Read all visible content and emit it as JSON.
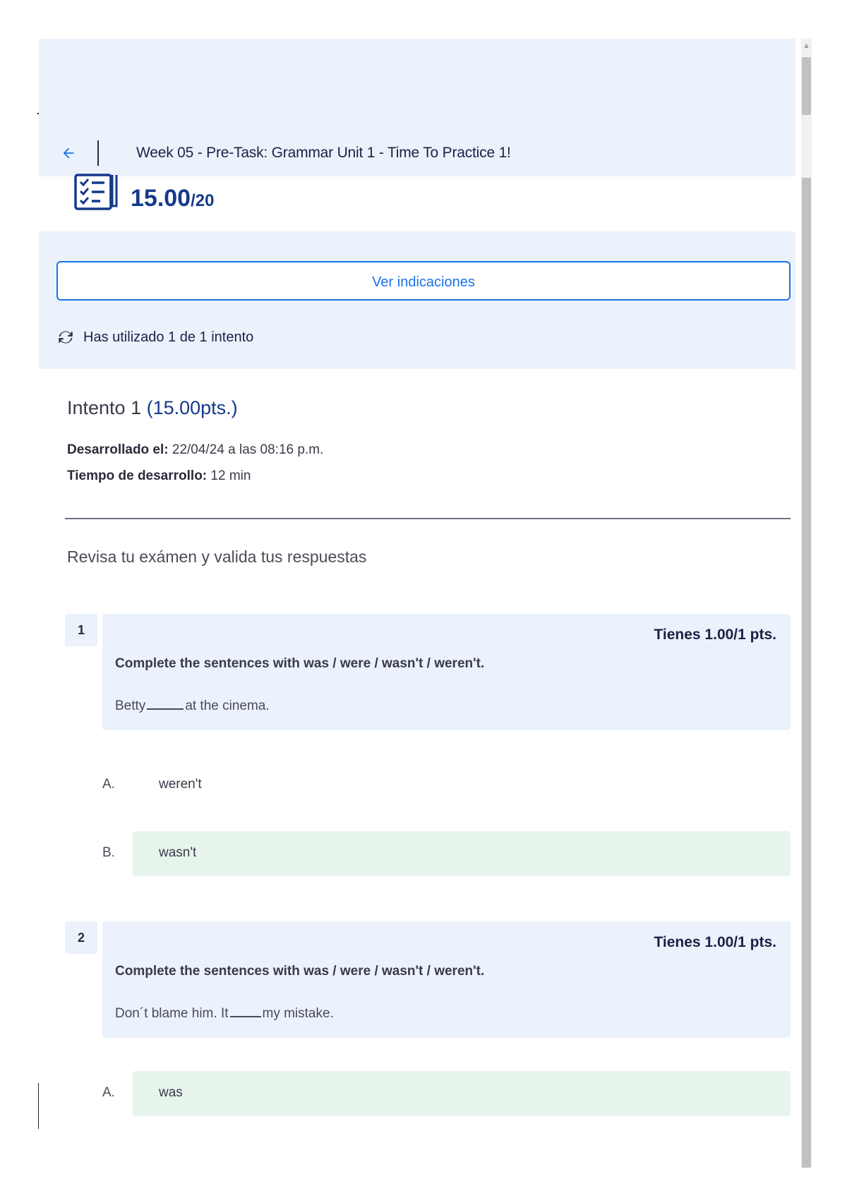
{
  "header": {
    "title": "Week 05 - Pre-Task: Grammar Unit 1 - Time To Practice 1!",
    "back_icon": "arrow-left-icon"
  },
  "score": {
    "value": "15.00",
    "total": "/20",
    "icon": "checklist-icon"
  },
  "info": {
    "indications_button": "Ver indicaciones",
    "attempts_text": "Has utilizado 1 de 1 intento",
    "attempts_icon": "refresh-icon"
  },
  "attempt": {
    "title": "Intento 1",
    "points": "(15.00pts.)",
    "developed_label": "Desarrollado el:",
    "developed_value": "22/04/24 a las 08:16 p.m.",
    "time_label": "Tiempo de desarrollo:",
    "time_value": "12 min"
  },
  "review_heading": "Revisa tu exámen y valida tus respuestas",
  "questions": [
    {
      "number": "1",
      "score": "Tienes 1.00/1 pts.",
      "instruction": "Complete the sentences with was / were / wasn't / weren't.",
      "sentence_before": "Betty",
      "sentence_after": "at the cinema.",
      "options": [
        {
          "letter": "A.",
          "text": "weren't",
          "selected": false
        },
        {
          "letter": "B.",
          "text": "wasn't",
          "selected": true
        }
      ]
    },
    {
      "number": "2",
      "score": "Tienes 1.00/1 pts.",
      "instruction": "Complete the sentences with was / were / wasn't / weren't.",
      "sentence_before": "Don´t blame him. It",
      "sentence_after": "my mistake.",
      "options": [
        {
          "letter": "A.",
          "text": "was",
          "selected": true
        }
      ]
    }
  ],
  "colors": {
    "accent": "#1a73e8",
    "score_blue": "#153a8a",
    "panel_bg": "#ebf2fc",
    "correct_bg": "#e7f4ec"
  }
}
